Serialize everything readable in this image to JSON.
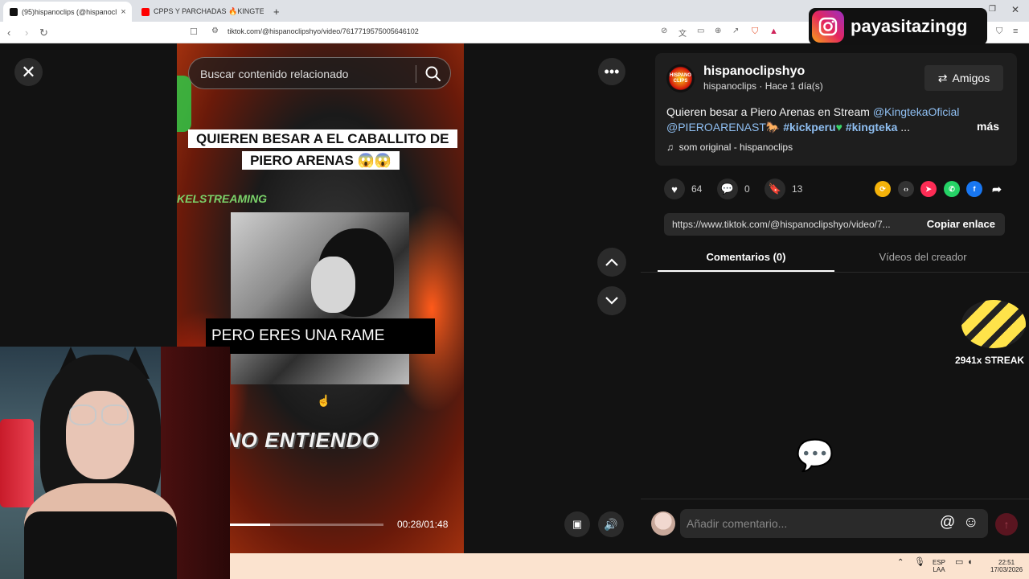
{
  "browser": {
    "tabs": [
      {
        "label": "(95)hispanoclips (@hispanocl",
        "active": true
      },
      {
        "label": "CPPS Y PARCHADAS 🔥KINGTEKA",
        "active": false
      }
    ],
    "new_tab": "+",
    "url": "tiktok.com/@hispanoclipshyo/video/7617719575005646102"
  },
  "video": {
    "search_placeholder": "Buscar contenido relacionado",
    "caption_top": "QUIEREN BESAR A EL CABALLITO DE PIERO ARENAS 😱😱",
    "watermark": "KELSTREAMING",
    "caption_middle": "PERO ERES UNA RAME",
    "caption_bottom": "NO ENTIENDO",
    "progress": 0.26,
    "time": "00:28/01:48"
  },
  "post": {
    "username": "hispanoclipshyo",
    "subline": "hispanoclips · Hace 1 día(s)",
    "avatar_text": "HISPANO CLIPS",
    "friends_button": "Amigos",
    "description_text": "Quieren besar a Piero Arenas en Stream ",
    "mention1": "@KingtekaOficial",
    "mention2": "@PIEROARENAST",
    "tag1": "#kickperu",
    "tag2": "#kingteka",
    "ellipsis": "...",
    "more": "más",
    "music": "som original - hispanoclips",
    "likes": "64",
    "comments": "0",
    "saves": "13",
    "link": "https://www.tiktok.com/@hispanoclipshyo/video/7...",
    "copy_link": "Copiar enlace",
    "tab_comments": "Comentarios (0)",
    "tab_videos": "Vídeos del creador",
    "comment_placeholder": "Añadir comentario..."
  },
  "overlay": {
    "instagram_handle": "payasitazingg",
    "streak_text": "2941x STREAK"
  },
  "taskbar": {
    "lang": "ESP",
    "lang2": "LAA",
    "time": "22:51",
    "date": "17/03/2026"
  },
  "colors": {
    "accent_link": "#8fbff2",
    "tiktok_red": "#fe2c55",
    "panel_bg": "#121212"
  }
}
